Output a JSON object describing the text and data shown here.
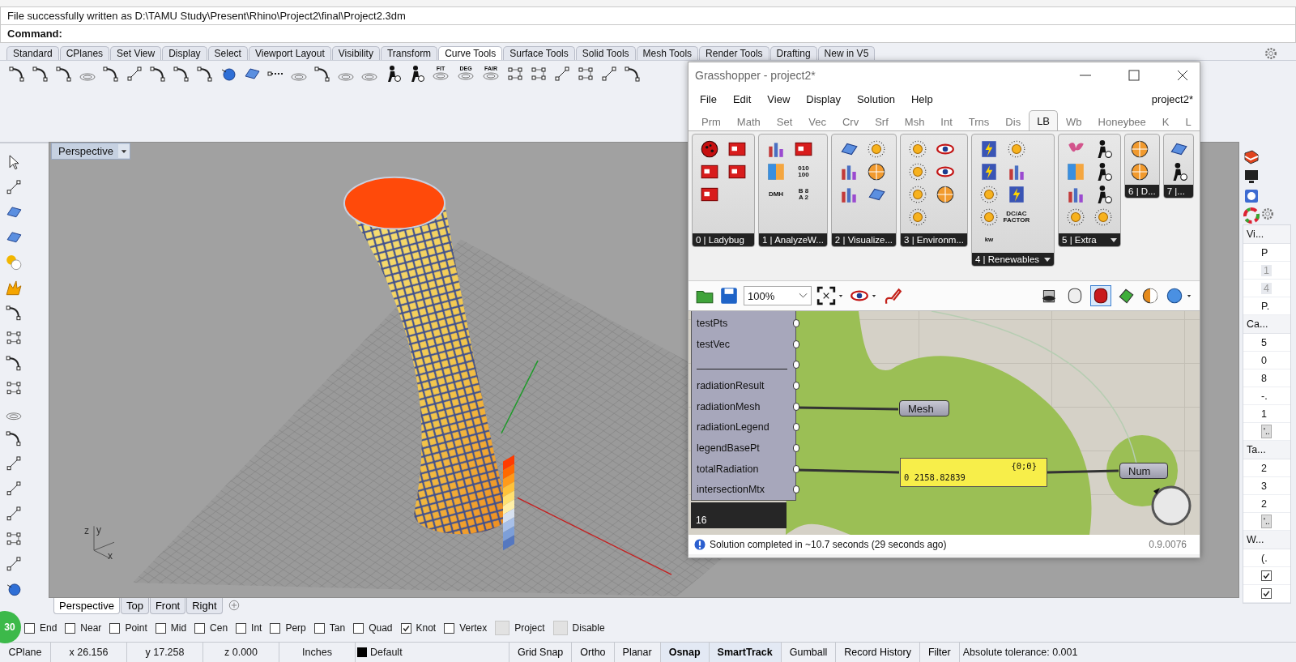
{
  "command_history": "File successfully written as D:\\TAMU Study\\Present\\Rhino\\Project2\\final\\Project2.3dm",
  "command_prompt": "Command:",
  "toolbar_tabs": [
    {
      "label": "Standard",
      "selected": false
    },
    {
      "label": "CPlanes",
      "selected": false
    },
    {
      "label": "Set View",
      "selected": false
    },
    {
      "label": "Display",
      "selected": false
    },
    {
      "label": "Select",
      "selected": false
    },
    {
      "label": "Viewport Layout",
      "selected": false
    },
    {
      "label": "Visibility",
      "selected": false
    },
    {
      "label": "Transform",
      "selected": false
    },
    {
      "label": "Curve Tools",
      "selected": true
    },
    {
      "label": "Surface Tools",
      "selected": false
    },
    {
      "label": "Solid Tools",
      "selected": false
    },
    {
      "label": "Mesh Tools",
      "selected": false
    },
    {
      "label": "Render Tools",
      "selected": false
    },
    {
      "label": "Drafting",
      "selected": false
    },
    {
      "label": "New in V5",
      "selected": false
    }
  ],
  "toolbar": {
    "icon_captions": [
      "FIT",
      "DEG",
      "FAIR"
    ]
  },
  "viewport": {
    "title": "Perspective",
    "axis_labels": [
      "z",
      "y",
      "x"
    ]
  },
  "grasshopper": {
    "title": "Grasshopper - project2*",
    "menu": [
      "File",
      "Edit",
      "View",
      "Display",
      "Solution",
      "Help"
    ],
    "document": "project2*",
    "tabs": [
      {
        "label": "Prm",
        "selected": false
      },
      {
        "label": "Math",
        "selected": false
      },
      {
        "label": "Set",
        "selected": false
      },
      {
        "label": "Vec",
        "selected": false
      },
      {
        "label": "Crv",
        "selected": false
      },
      {
        "label": "Srf",
        "selected": false
      },
      {
        "label": "Msh",
        "selected": false
      },
      {
        "label": "Int",
        "selected": false
      },
      {
        "label": "Trns",
        "selected": false
      },
      {
        "label": "Dis",
        "selected": false
      },
      {
        "label": "LB",
        "selected": true
      },
      {
        "label": "Wb",
        "selected": false
      },
      {
        "label": "Honeybee",
        "selected": false
      },
      {
        "label": "K",
        "selected": false
      },
      {
        "label": "L",
        "selected": false
      }
    ],
    "ribbon_groups": [
      {
        "label": "0 | Ladybug",
        "expandable": false
      },
      {
        "label": "1 | AnalyzeW...",
        "text_icons": [
          "010\n100",
          "DMH",
          "B 8\nA 2"
        ],
        "expandable": false
      },
      {
        "label": "2 | Visualize...",
        "expandable": false
      },
      {
        "label": "3 | Environm...",
        "expandable": false
      },
      {
        "label": "4 | Renewables",
        "text_icons": [
          "DC/AC\nFACTOR",
          "kw"
        ],
        "expandable": true
      },
      {
        "label": "5 | Extra",
        "expandable": true
      },
      {
        "label": "6 | D...",
        "expandable": false
      },
      {
        "label": "7 |...",
        "expandable": false
      }
    ],
    "zoom": "100%",
    "preview_modes": [
      {
        "selected": false
      },
      {
        "selected": false
      },
      {
        "selected": true
      }
    ],
    "component_outputs": [
      {
        "kind": "param",
        "label": "testPts"
      },
      {
        "kind": "param",
        "label": "testVec"
      },
      {
        "kind": "separator"
      },
      {
        "kind": "param",
        "label": "radiationResult"
      },
      {
        "kind": "param",
        "label": "radiationMesh"
      },
      {
        "kind": "param",
        "label": "radiationLegend"
      },
      {
        "kind": "param",
        "label": "legendBasePt"
      },
      {
        "kind": "param",
        "label": "totalRadiation"
      },
      {
        "kind": "param",
        "label": "intersectionMtx"
      }
    ],
    "component_footer": "16",
    "nodes": {
      "mesh": "Mesh",
      "panel_path": "{0;0}",
      "panel_value": "0 2158.82839",
      "number": "Num"
    },
    "status": "Solution completed in ~10.7 seconds (29 seconds ago)",
    "version": "0.9.0076"
  },
  "viewport_tabs": [
    {
      "label": "Perspective",
      "selected": true
    },
    {
      "label": "Top",
      "selected": false
    },
    {
      "label": "Front",
      "selected": false
    },
    {
      "label": "Right",
      "selected": false
    }
  ],
  "recording_badge": "30",
  "osnaps": [
    {
      "kind": "check",
      "label": "End",
      "checked": false
    },
    {
      "kind": "check",
      "label": "Near",
      "checked": false
    },
    {
      "kind": "check",
      "label": "Point",
      "checked": false
    },
    {
      "kind": "check",
      "label": "Mid",
      "checked": false
    },
    {
      "kind": "check",
      "label": "Cen",
      "checked": false
    },
    {
      "kind": "check",
      "label": "Int",
      "checked": false
    },
    {
      "kind": "check",
      "label": "Perp",
      "checked": false
    },
    {
      "kind": "check",
      "label": "Tan",
      "checked": false
    },
    {
      "kind": "check",
      "label": "Quad",
      "checked": false
    },
    {
      "kind": "check",
      "label": "Knot",
      "checked": true
    },
    {
      "kind": "check",
      "label": "Vertex",
      "checked": false
    },
    {
      "kind": "toggle",
      "label": "Project",
      "checked": false
    },
    {
      "kind": "toggle",
      "label": "Disable",
      "checked": false
    }
  ],
  "status_bar": [
    {
      "kind": "text",
      "text": "CPlane"
    },
    {
      "kind": "coordinate",
      "text": "x 26.156"
    },
    {
      "kind": "coordinate",
      "text": "y 17.258"
    },
    {
      "kind": "coordinate",
      "text": "z 0.000"
    },
    {
      "kind": "coordinate",
      "text": "Inches"
    },
    {
      "kind": "layer",
      "text": "Default",
      "color": "#000000"
    },
    {
      "kind": "toggle",
      "text": "Grid Snap",
      "on": false
    },
    {
      "kind": "toggle",
      "text": "Ortho",
      "on": false
    },
    {
      "kind": "toggle",
      "text": "Planar",
      "on": false
    },
    {
      "kind": "toggle",
      "text": "Osnap",
      "on": true
    },
    {
      "kind": "toggle",
      "text": "SmartTrack",
      "on": true
    },
    {
      "kind": "toggle",
      "text": "Gumball",
      "on": false
    },
    {
      "kind": "toggle",
      "text": "Record History",
      "on": false
    },
    {
      "kind": "toggle",
      "text": "Filter",
      "on": false
    },
    {
      "kind": "text",
      "text": "Absolute tolerance: 0.001"
    }
  ],
  "properties": {
    "sections": [
      {
        "header": "Vi...",
        "rows": [
          {
            "kind": "text",
            "value": "P",
            "disabled": false
          },
          {
            "kind": "text",
            "value": "1",
            "disabled": true
          },
          {
            "kind": "text",
            "value": "4",
            "disabled": true
          },
          {
            "kind": "text",
            "value": "P.",
            "disabled": false
          }
        ]
      },
      {
        "header": "Ca...",
        "rows": [
          {
            "kind": "text",
            "value": "5",
            "disabled": false
          },
          {
            "kind": "text",
            "value": "0",
            "disabled": false
          },
          {
            "kind": "text",
            "value": "8",
            "disabled": false
          },
          {
            "kind": "text",
            "value": "-.",
            "disabled": false
          },
          {
            "kind": "text",
            "value": "1",
            "disabled": false
          },
          {
            "kind": "button",
            "value": "'..",
            "disabled": false
          }
        ]
      },
      {
        "header": "Ta...",
        "rows": [
          {
            "kind": "text",
            "value": "2",
            "disabled": false
          },
          {
            "kind": "text",
            "value": "3",
            "disabled": false
          },
          {
            "kind": "text",
            "value": "2",
            "disabled": false
          },
          {
            "kind": "button",
            "value": "'..",
            "disabled": false
          }
        ]
      },
      {
        "header": "W...",
        "rows": [
          {
            "kind": "text",
            "value": "(.",
            "disabled": false
          },
          {
            "kind": "checkbox",
            "checked": true,
            "disabled": false
          },
          {
            "kind": "checkbox",
            "checked": true,
            "disabled": false
          }
        ]
      }
    ]
  }
}
